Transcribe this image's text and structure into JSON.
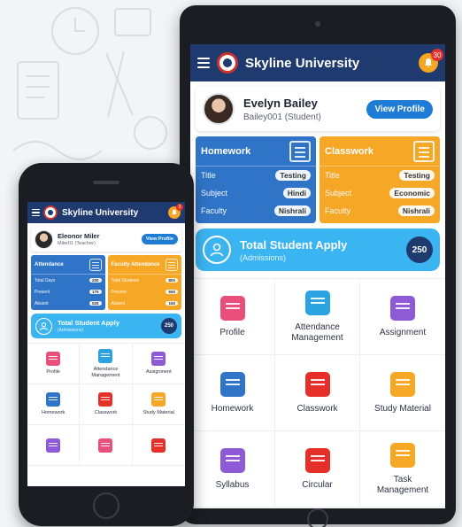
{
  "tablet": {
    "app_name": "Skyline University",
    "notification_count": "30",
    "profile": {
      "name": "Evelyn Bailey",
      "id": "Bailey001 (Student)",
      "button": "View Profile"
    },
    "cards": [
      {
        "title": "Homework",
        "color": "#2f74c7",
        "rows": [
          {
            "label": "Title",
            "value": "Testing"
          },
          {
            "label": "Subject",
            "value": "Hindi"
          },
          {
            "label": "Faculty",
            "value": "Nishrali"
          }
        ]
      },
      {
        "title": "Classwork",
        "color": "#f6a726",
        "rows": [
          {
            "label": "Title",
            "value": "Testing"
          },
          {
            "label": "Subject",
            "value": "Economic"
          },
          {
            "label": "Faculty",
            "value": "Nishrali"
          }
        ]
      }
    ],
    "apply": {
      "title": "Total Student Apply",
      "subtitle": "(Admissions)",
      "count": "250"
    },
    "menu": [
      {
        "label": "Profile",
        "icon": "profile-icon",
        "color": "#e84f7a"
      },
      {
        "label": "Attendance Management",
        "icon": "attendance-icon",
        "color": "#2aa3e0"
      },
      {
        "label": "Assignment",
        "icon": "assignment-icon",
        "color": "#8e5ad6"
      },
      {
        "label": "Homework",
        "icon": "homework-icon",
        "color": "#2f74c7"
      },
      {
        "label": "Classwork",
        "icon": "classwork-icon",
        "color": "#e5302a"
      },
      {
        "label": "Study Material",
        "icon": "study-material-icon",
        "color": "#f6a726"
      },
      {
        "label": "Syllabus",
        "icon": "syllabus-icon",
        "color": "#8e5ad6"
      },
      {
        "label": "Circular",
        "icon": "circular-icon",
        "color": "#e5302a"
      },
      {
        "label": "Task Management",
        "icon": "task-icon",
        "color": "#f6a726"
      }
    ]
  },
  "phone": {
    "app_name": "Skyline University",
    "notification_count": "3",
    "profile": {
      "name": "Eleonor Miler",
      "id": "Miler01 (Teacher)",
      "button": "View Profile"
    },
    "cards": [
      {
        "title": "Attendance",
        "color": "#2f74c7",
        "rows": [
          {
            "label": "Total Days",
            "value": "200"
          },
          {
            "label": "Present",
            "value": "175"
          },
          {
            "label": "Absent",
            "value": "025"
          }
        ]
      },
      {
        "title": "Faculty Attendance",
        "color": "#f6a726",
        "rows": [
          {
            "label": "Total Students",
            "value": "800"
          },
          {
            "label": "Present",
            "value": "650"
          },
          {
            "label": "Absent",
            "value": "150"
          }
        ]
      }
    ],
    "apply": {
      "title": "Total Student Apply",
      "subtitle": "(Admissions)",
      "count": "250"
    },
    "menu": [
      {
        "label": "Profile",
        "icon": "profile-icon",
        "color": "#e84f7a"
      },
      {
        "label": "Attendance Management",
        "icon": "attendance-icon",
        "color": "#2aa3e0"
      },
      {
        "label": "Assignment",
        "icon": "assignment-icon",
        "color": "#8e5ad6"
      },
      {
        "label": "Homework",
        "icon": "homework-icon",
        "color": "#2f74c7"
      },
      {
        "label": "Classwork",
        "icon": "classwork-icon",
        "color": "#e5302a"
      },
      {
        "label": "Study Material",
        "icon": "study-material-icon",
        "color": "#f6a726"
      },
      {
        "label": "",
        "icon": "syllabus-icon",
        "color": "#8e5ad6"
      },
      {
        "label": "",
        "icon": "task-icon",
        "color": "#e84f7a"
      },
      {
        "label": "",
        "icon": "circular-icon",
        "color": "#e5302a"
      }
    ]
  }
}
